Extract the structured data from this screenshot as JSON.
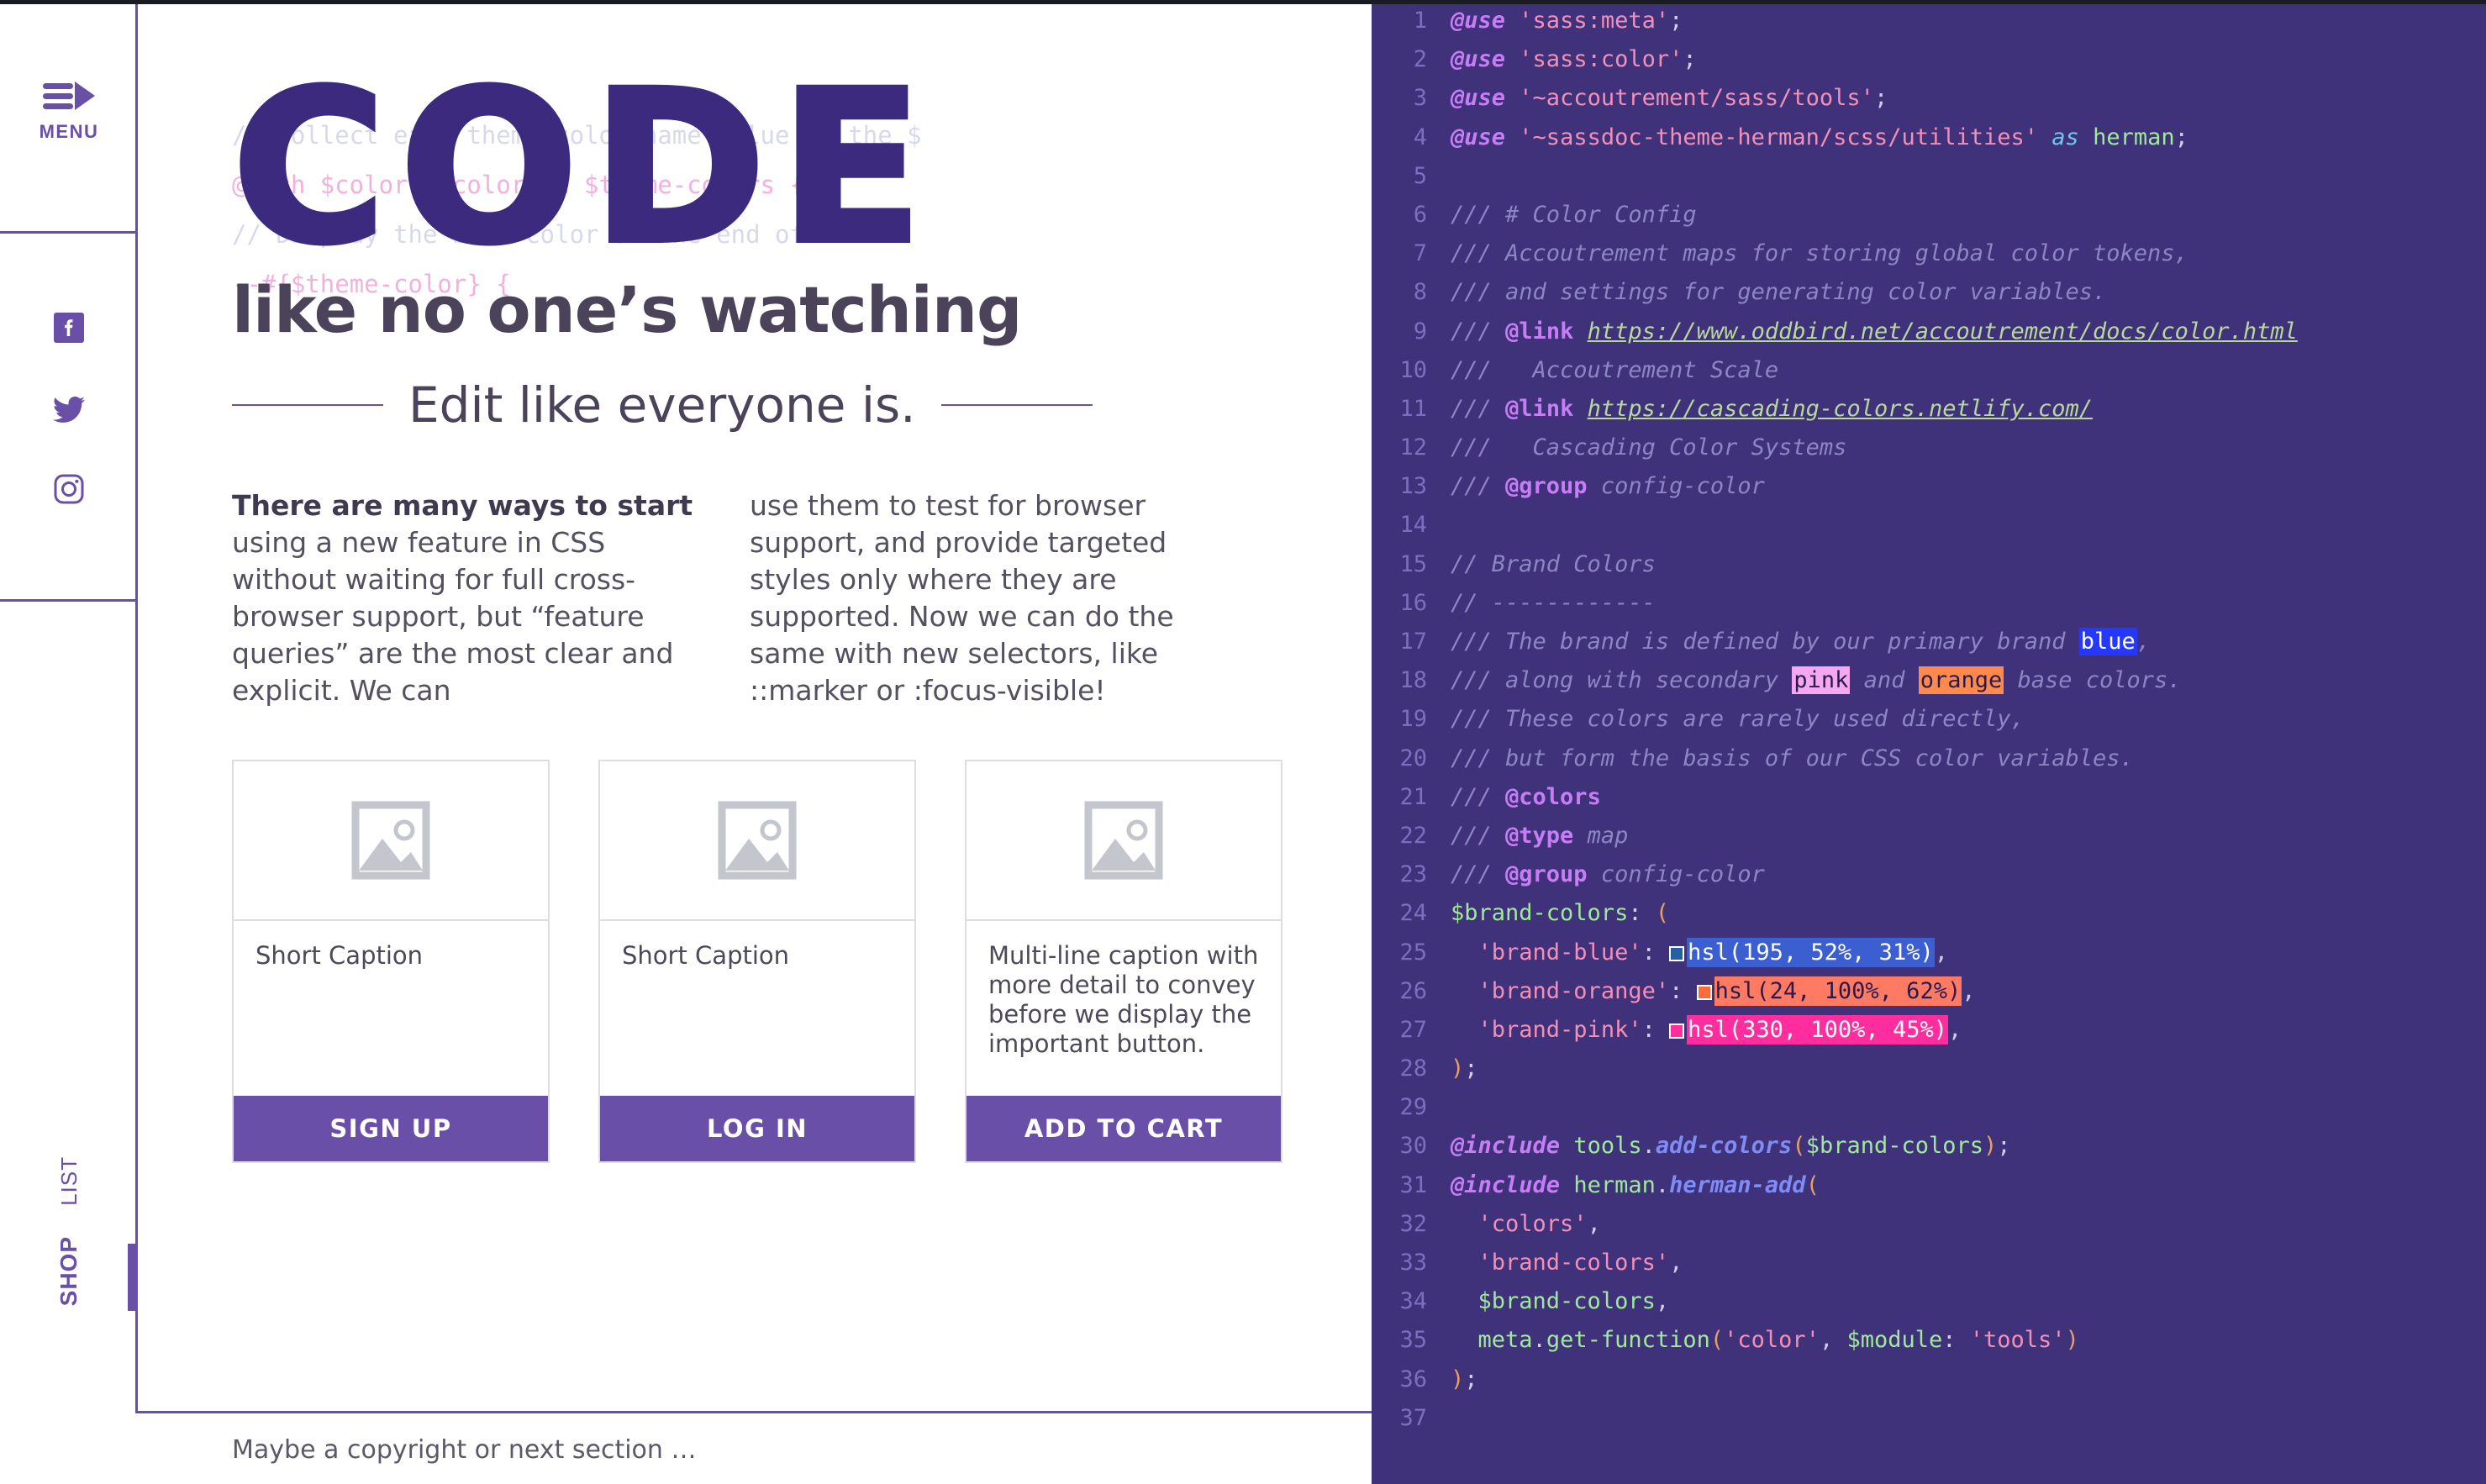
{
  "colors": {
    "brand_purple": "#6a4fa8",
    "deep_purple": "#3b2a7e",
    "code_bg": "#3f327a",
    "ink": "#4a4359"
  },
  "nav": {
    "menu_label": "MENU",
    "social": [
      {
        "name": "facebook-icon",
        "label": "Facebook"
      },
      {
        "name": "twitter-icon",
        "label": "Twitter"
      },
      {
        "name": "instagram-icon",
        "label": "Instagram"
      }
    ],
    "vertical_links": [
      {
        "label": "LIST",
        "active": false
      },
      {
        "label": "SHOP",
        "active": true
      }
    ]
  },
  "hero": {
    "title": "CODE",
    "subtitle": "like no one’s watching",
    "tagline": "Edit like everyone is.",
    "background_code": [
      "// Collect each theme color name value in the $",
      "@each $color, $color in $theme-colors {",
      "// Display the base color at the end of",
      "--#{$theme-color} {"
    ]
  },
  "body": {
    "col1_lead": "There are many ways to start",
    "col1_rest": " using a new feature in CSS without waiting for full cross-browser support, but “feature queries” are the most clear and explicit. We can",
    "col2": "use them to test for browser support, and provide targeted styles only where they are supported. Now we can do the same with new selectors, like ::marker or :focus-visible!"
  },
  "cards": [
    {
      "caption": "Short Caption",
      "button": "SIGN UP",
      "thumb_icon": "image-placeholder-icon"
    },
    {
      "caption": "Short Caption",
      "button": "LOG IN",
      "thumb_icon": "image-placeholder-icon"
    },
    {
      "caption": "Multi-line caption with more detail to convey before we display the important button.",
      "button": "ADD TO CART",
      "thumb_icon": "image-placeholder-icon"
    }
  ],
  "footer": {
    "text": "Maybe a copyright or next section …"
  },
  "code_panel": {
    "language": "scss",
    "lines": [
      {
        "n": 1,
        "text": "@use 'sass:meta';"
      },
      {
        "n": 2,
        "text": "@use 'sass:color';"
      },
      {
        "n": 3,
        "text": "@use '~accoutrement/sass/tools';"
      },
      {
        "n": 4,
        "text": "@use '~sassdoc-theme-herman/scss/utilities' as herman;"
      },
      {
        "n": 5,
        "text": ""
      },
      {
        "n": 6,
        "text": "/// # Color Config"
      },
      {
        "n": 7,
        "text": "/// Accoutrement maps for storing global color tokens,"
      },
      {
        "n": 8,
        "text": "/// and settings for generating color variables."
      },
      {
        "n": 9,
        "text": "/// @link https://www.oddbird.net/accoutrement/docs/color.html"
      },
      {
        "n": 10,
        "text": "///   Accoutrement Scale"
      },
      {
        "n": 11,
        "text": "/// @link https://cascading-colors.netlify.com/"
      },
      {
        "n": 12,
        "text": "///   Cascading Color Systems"
      },
      {
        "n": 13,
        "text": "/// @group config-color"
      },
      {
        "n": 14,
        "text": ""
      },
      {
        "n": 15,
        "text": "// Brand Colors"
      },
      {
        "n": 16,
        "text": "// ------------"
      },
      {
        "n": 17,
        "text": "/// The brand is defined by our primary brand blue,"
      },
      {
        "n": 18,
        "text": "/// along with secondary pink and orange base colors."
      },
      {
        "n": 19,
        "text": "/// These colors are rarely used directly,"
      },
      {
        "n": 20,
        "text": "/// but form the basis of our CSS color variables."
      },
      {
        "n": 21,
        "text": "/// @colors"
      },
      {
        "n": 22,
        "text": "/// @type map"
      },
      {
        "n": 23,
        "text": "/// @group config-color"
      },
      {
        "n": 24,
        "text": "$brand-colors: ("
      },
      {
        "n": 25,
        "text": "  'brand-blue': hsl(195, 52%, 31%),"
      },
      {
        "n": 26,
        "text": "  'brand-orange': hsl(24, 100%, 62%),"
      },
      {
        "n": 27,
        "text": "  'brand-pink': hsl(330, 100%, 45%),"
      },
      {
        "n": 28,
        "text": ");"
      },
      {
        "n": 29,
        "text": ""
      },
      {
        "n": 30,
        "text": "@include tools.add-colors($brand-colors);"
      },
      {
        "n": 31,
        "text": "@include herman.herman-add("
      },
      {
        "n": 32,
        "text": "  'colors',"
      },
      {
        "n": 33,
        "text": "  'brand-colors',"
      },
      {
        "n": 34,
        "text": "  $brand-colors,"
      },
      {
        "n": 35,
        "text": "  meta.get-function('color', $module: 'tools')"
      },
      {
        "n": 36,
        "text": ");"
      },
      {
        "n": 37,
        "text": ""
      }
    ],
    "inline_swatches": {
      "blue": {
        "word": "blue",
        "bg": "#2438ff",
        "fg": "#ffffff"
      },
      "pink": {
        "word": "pink",
        "bg": "#f5a8f0",
        "fg": "#2b1a50"
      },
      "orange": {
        "word": "orange",
        "bg": "#ff8a4c",
        "fg": "#2b1a50"
      }
    },
    "color_values": [
      {
        "key": "'brand-blue'",
        "value": "hsl(195, 52%, 31%)",
        "swatch": "#2560a0",
        "highlight": "#3b5fd0"
      },
      {
        "key": "'brand-orange'",
        "value": "hsl(24, 100%, 62%)",
        "swatch": "#ff6b3d",
        "highlight": "#ff7a62"
      },
      {
        "key": "'brand-pink'",
        "value": "hsl(330, 100%, 45%)",
        "swatch": "#ff2d9e",
        "highlight": "#ff2d9e"
      }
    ]
  }
}
